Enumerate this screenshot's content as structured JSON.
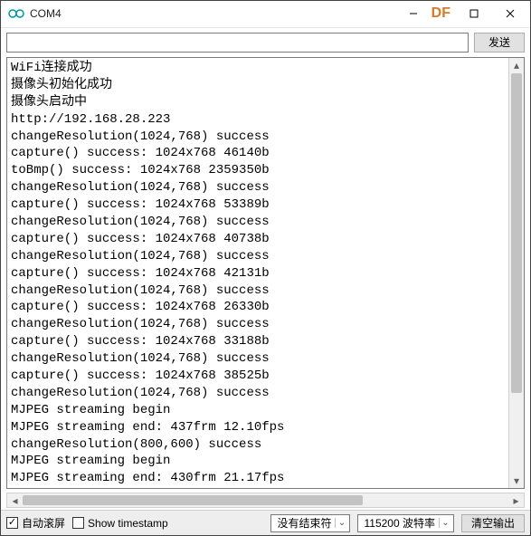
{
  "window": {
    "title": "COM4",
    "watermark": "DF"
  },
  "input": {
    "value": "",
    "placeholder": ""
  },
  "buttons": {
    "send": "发送",
    "clear": "清空输出"
  },
  "footer": {
    "autoscroll_label": "自动滚屏",
    "autoscroll_checked": true,
    "timestamp_label": "Show timestamp",
    "timestamp_checked": false,
    "line_ending": "没有结束符",
    "baud": "115200 波特率"
  },
  "output_lines": [
    "WiFi连接成功",
    "摄像头初始化成功",
    "摄像头启动中",
    "http://192.168.28.223",
    "changeResolution(1024,768) success",
    "capture() success: 1024x768 46140b",
    "toBmp() success: 1024x768 2359350b",
    "changeResolution(1024,768) success",
    "capture() success: 1024x768 53389b",
    "changeResolution(1024,768) success",
    "capture() success: 1024x768 40738b",
    "changeResolution(1024,768) success",
    "capture() success: 1024x768 42131b",
    "changeResolution(1024,768) success",
    "capture() success: 1024x768 26330b",
    "changeResolution(1024,768) success",
    "capture() success: 1024x768 33188b",
    "changeResolution(1024,768) success",
    "capture() success: 1024x768 38525b",
    "changeResolution(1024,768) success",
    "MJPEG streaming begin",
    "MJPEG streaming end: 437frm 12.10fps",
    "changeResolution(800,600) success",
    "MJPEG streaming begin",
    "MJPEG streaming end: 430frm 21.17fps"
  ]
}
